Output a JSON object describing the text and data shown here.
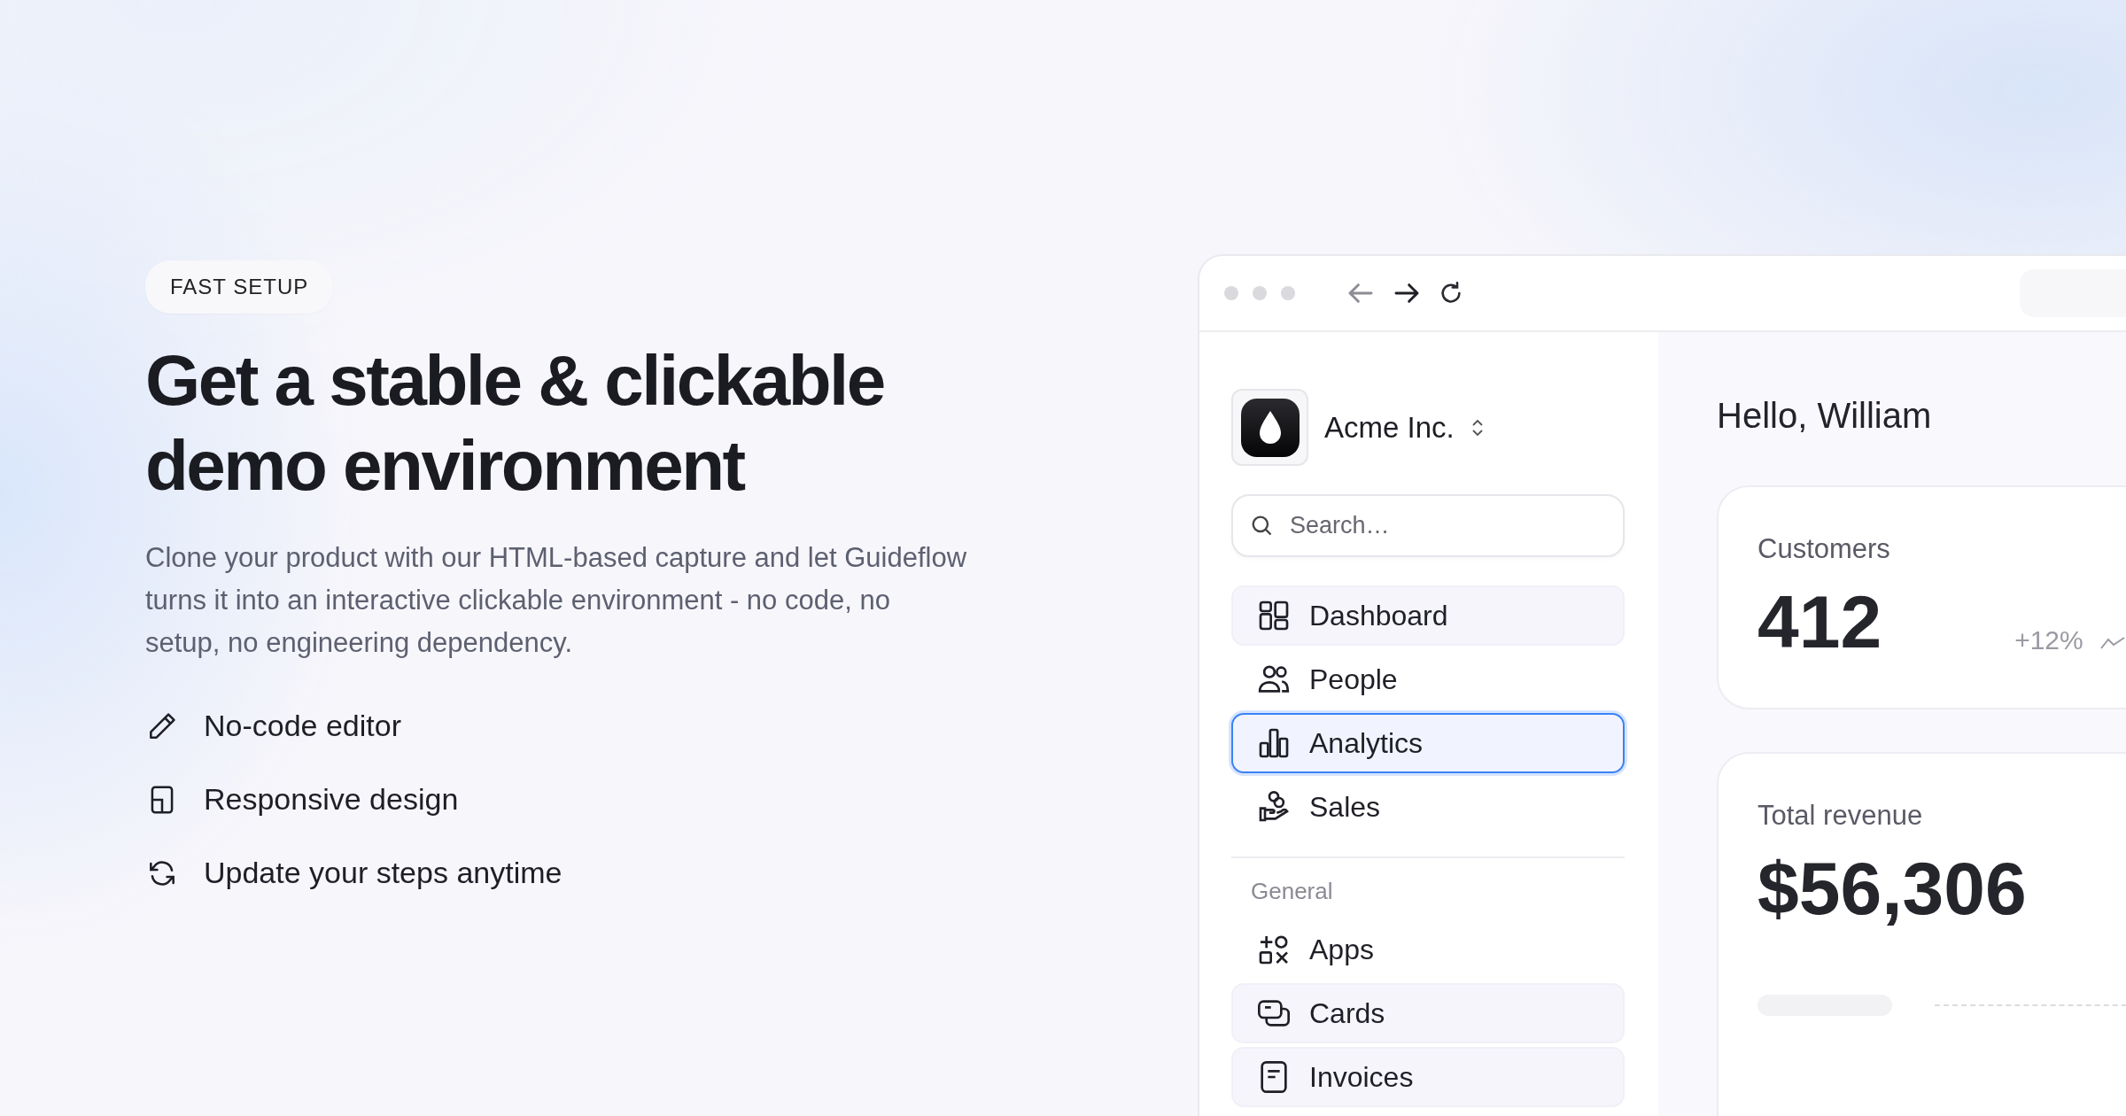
{
  "hero": {
    "badge": "FAST SETUP",
    "title": "Get a stable & clickable demo environment",
    "description": "Clone your product with our HTML-based capture and let Guideflow turns it into an interactive clickable environment - no code, no setup, no engineering dependency.",
    "features": [
      {
        "label": "No-code editor"
      },
      {
        "label": "Responsive design"
      },
      {
        "label": "Update your steps anytime"
      }
    ]
  },
  "browser": {
    "workspace": {
      "name": "Acme Inc."
    },
    "search": {
      "placeholder": "Search…"
    },
    "nav": [
      {
        "label": "Dashboard",
        "selected": false,
        "highlighted": true
      },
      {
        "label": "People",
        "selected": false,
        "highlighted": false
      },
      {
        "label": "Analytics",
        "selected": true,
        "highlighted": false
      },
      {
        "label": "Sales",
        "selected": false,
        "highlighted": false
      }
    ],
    "section_label": "General",
    "general_nav": [
      {
        "label": "Apps",
        "selected": false,
        "highlighted": false
      },
      {
        "label": "Cards",
        "selected": false,
        "highlighted": true
      },
      {
        "label": "Invoices",
        "selected": false,
        "highlighted": true
      }
    ],
    "greeting": "Hello, William",
    "stats": [
      {
        "label": "Customers",
        "value": "412",
        "change": "+12%"
      },
      {
        "label": "Total revenue",
        "value": "$56,306"
      }
    ]
  }
}
